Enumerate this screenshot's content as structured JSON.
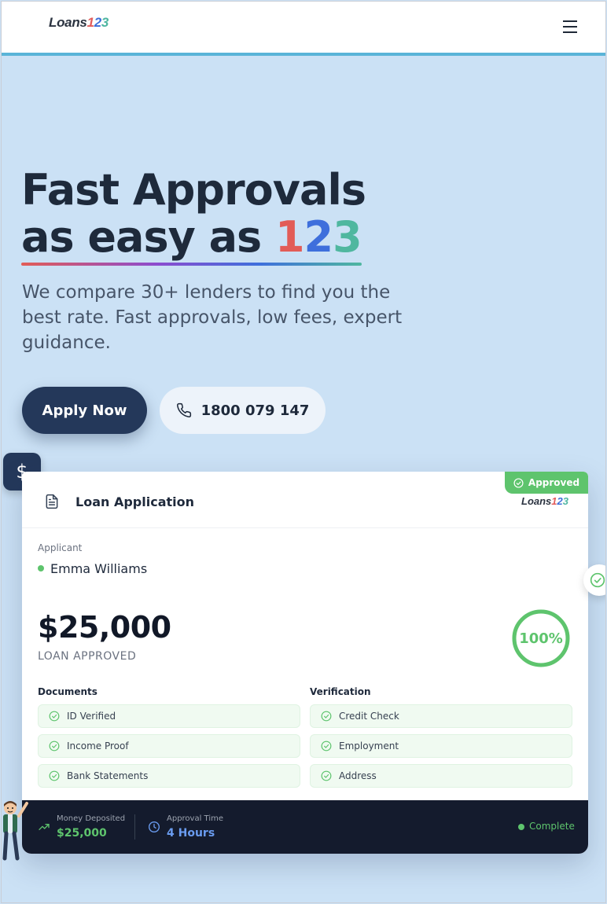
{
  "header": {
    "logo": {
      "text": "Loans",
      "d1": "1",
      "d2": "2",
      "d3": "3"
    },
    "menu_icon": "hamburger-menu-icon"
  },
  "hero": {
    "title_line1": "Fast Approvals",
    "title_line2": "as easy as ",
    "title_d1": "1",
    "title_d2": "2",
    "title_d3": "3",
    "subtitle": "We compare 30+ lenders to find you the best rate. Fast approvals, low fees, expert guidance.",
    "apply_label": "Apply Now",
    "phone_label": "1800 079 147"
  },
  "card": {
    "title": "Loan Application",
    "approved_badge": "Approved",
    "logo": {
      "text": "Loans",
      "d1": "1",
      "d2": "2",
      "d3": "3"
    },
    "applicant_label": "Applicant",
    "applicant_name": "Emma Williams",
    "amount": "$25,000",
    "amount_label": "LOAN APPROVED",
    "progress_percent": 100,
    "progress_text": "100%",
    "documents_title": "Documents",
    "documents": [
      "ID Verified",
      "Income Proof",
      "Bank Statements"
    ],
    "verification_title": "Verification",
    "verification": [
      "Credit Check",
      "Employment",
      "Address"
    ],
    "footer": {
      "deposited_label": "Money Deposited",
      "deposited_value": "$25,000",
      "time_label": "Approval Time",
      "time_value": "4 Hours",
      "status": "Complete"
    }
  },
  "colors": {
    "navy": "#24385a",
    "green": "#5ec46d",
    "accent_bar": "#5ab4d8",
    "digit1": "#e25c57",
    "digit2": "#3e6fdc",
    "digit3": "#4fb79f",
    "time_value": "#6a9cf0"
  }
}
